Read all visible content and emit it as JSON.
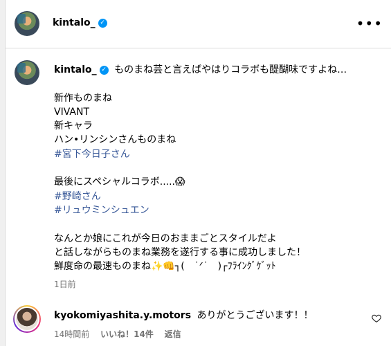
{
  "header": {
    "username": "kintalo_"
  },
  "post": {
    "author": "kintalo_",
    "lines": [
      {
        "text": "ものまね芸と言えばやはりコラボも醍醐味ですよね…",
        "type": "caption"
      },
      {
        "text": "",
        "type": "blank"
      },
      {
        "text": "新作ものまね",
        "type": "text"
      },
      {
        "text": "VIVANT",
        "type": "text"
      },
      {
        "text": "新キャラ",
        "type": "text"
      },
      {
        "text": "ハン•リンシンさんものまね",
        "type": "text"
      },
      {
        "text": "#宮下今日子さん",
        "type": "hashtag"
      },
      {
        "text": "",
        "type": "blank"
      },
      {
        "text": "最後にスペシャルコラボ.....😱",
        "type": "text"
      },
      {
        "text": "#野崎さん",
        "type": "hashtag"
      },
      {
        "text": "#リュウミンシュエン",
        "type": "hashtag"
      },
      {
        "text": "",
        "type": "blank"
      },
      {
        "text": "なんとか娘にこれが今日のおままごとスタイルだよ",
        "type": "text"
      },
      {
        "text": "と話しながらものまね業務を遂行する事に成功しました！",
        "type": "text"
      },
      {
        "text": "鮮度命の最速ものまね✨👊┐(　˙ᐟ˙　)┌ﾌﾗｲﾝｸﾞｹﾞｯﾄ",
        "type": "text"
      }
    ],
    "timestamp": "1日前"
  },
  "comment": {
    "username": "kyokomiyashita.y.motors",
    "text": "ありがとうございます！！",
    "time": "14時間前",
    "likes": "いいね！14件",
    "reply": "返信"
  },
  "icons": {
    "verified": "verified-badge-icon",
    "more": "more-options-icon",
    "heart": "heart-outline-icon"
  }
}
